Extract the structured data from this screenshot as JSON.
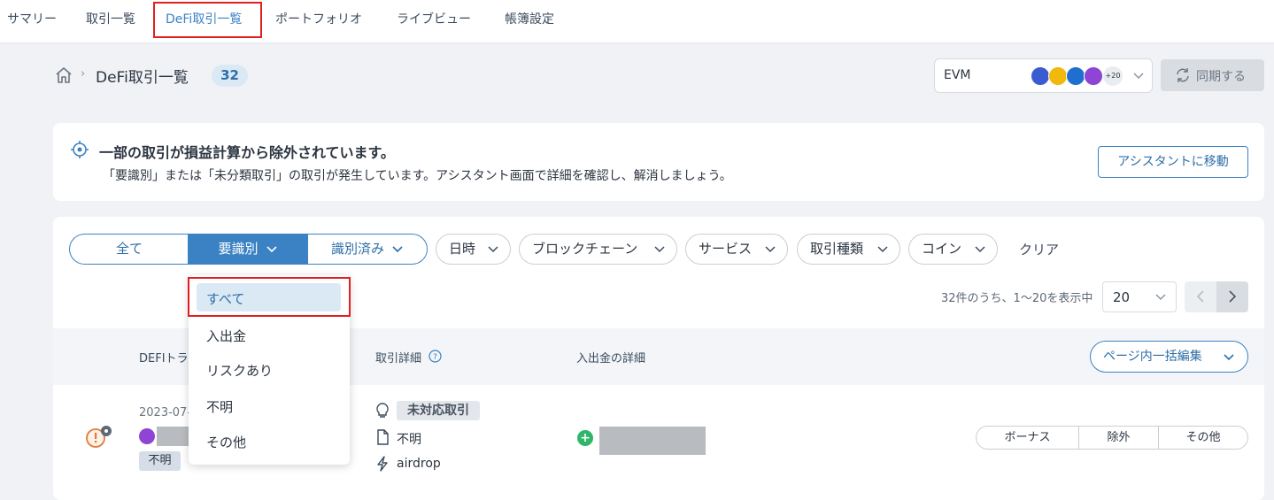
{
  "nav": {
    "tabs": [
      "サマリー",
      "取引一覧",
      "DeFi取引一覧",
      "ポートフォリオ",
      "ライブビュー",
      "帳簿設定"
    ],
    "active": "DeFi取引一覧"
  },
  "header": {
    "breadcrumb_sep": "›",
    "title": "DeFi取引一覧",
    "count": "32",
    "chain_select": {
      "label": "EVM",
      "more": "+20"
    },
    "sync_label": "同期する"
  },
  "alert": {
    "title": "一部の取引が損益計算から除外されています。",
    "description": "「要識別」または「未分類取引」の取引が発生しています。アシスタント画面で詳細を確認し、解消しましょう。",
    "button": "アシスタントに移動"
  },
  "filters": {
    "segments": [
      "全て",
      "要識別",
      "識別済み"
    ],
    "pills": [
      "日時",
      "ブロックチェーン",
      "サービス",
      "取引種類",
      "コイン"
    ],
    "clear": "クリア"
  },
  "dropdown": {
    "items": [
      "すべて",
      "入出金",
      "リスクあり",
      "不明",
      "その他"
    ],
    "selected": "すべて"
  },
  "pagination": {
    "info": "32件のうち、1〜20を表示中",
    "per_page": "20"
  },
  "table": {
    "headers": [
      "DEFIトラ",
      "取引詳細",
      "入出金の詳細"
    ],
    "bulk_edit": "ページ内一括編集",
    "row": {
      "date": "2023-07-",
      "status_tag": "不明",
      "detail_tag": "未対応取引",
      "detail_type": "不明",
      "detail_action": "airdrop",
      "actions": [
        "ボーナス",
        "除外",
        "その他"
      ]
    }
  },
  "colors": {
    "accent": "#3b82c4",
    "highlight_box": "#e02020",
    "warning": "#e07b39",
    "plus": "#2fb66a"
  }
}
